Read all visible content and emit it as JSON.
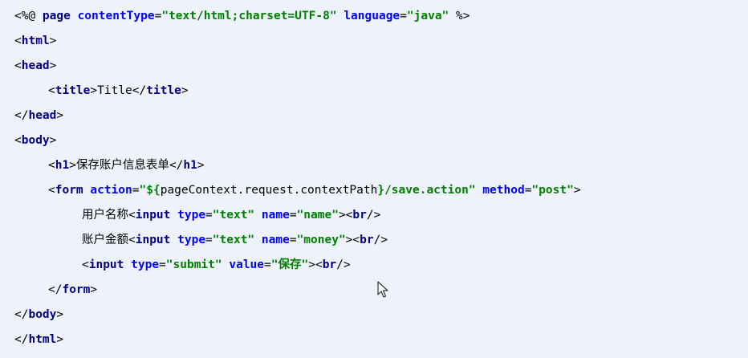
{
  "lines": [
    {
      "indent": 0,
      "tokens": [
        {
          "t": "<%@ ",
          "k": "punct"
        },
        {
          "t": "page",
          "k": "dir"
        },
        {
          "t": " ",
          "k": "text"
        },
        {
          "t": "contentType",
          "k": "attr"
        },
        {
          "t": "=",
          "k": "punct"
        },
        {
          "t": "\"text/html;charset=UTF-8\"",
          "k": "str"
        },
        {
          "t": " ",
          "k": "text"
        },
        {
          "t": "language",
          "k": "attr"
        },
        {
          "t": "=",
          "k": "punct"
        },
        {
          "t": "\"java\"",
          "k": "str"
        },
        {
          "t": " %>",
          "k": "punct"
        }
      ]
    },
    {
      "indent": 0,
      "tokens": [
        {
          "t": "<",
          "k": "punct"
        },
        {
          "t": "html",
          "k": "tag"
        },
        {
          "t": ">",
          "k": "punct"
        }
      ]
    },
    {
      "indent": 0,
      "tokens": [
        {
          "t": "<",
          "k": "punct"
        },
        {
          "t": "head",
          "k": "tag"
        },
        {
          "t": ">",
          "k": "punct"
        }
      ]
    },
    {
      "indent": 1,
      "tokens": [
        {
          "t": "<",
          "k": "punct"
        },
        {
          "t": "title",
          "k": "tag"
        },
        {
          "t": ">",
          "k": "punct"
        },
        {
          "t": "Title",
          "k": "text"
        },
        {
          "t": "</",
          "k": "punct"
        },
        {
          "t": "title",
          "k": "tag"
        },
        {
          "t": ">",
          "k": "punct"
        }
      ]
    },
    {
      "indent": 0,
      "tokens": [
        {
          "t": "</",
          "k": "punct"
        },
        {
          "t": "head",
          "k": "tag"
        },
        {
          "t": ">",
          "k": "punct"
        }
      ]
    },
    {
      "indent": 0,
      "tokens": [
        {
          "t": "<",
          "k": "punct"
        },
        {
          "t": "body",
          "k": "tag"
        },
        {
          "t": ">",
          "k": "punct"
        }
      ]
    },
    {
      "indent": 1,
      "tokens": [
        {
          "t": "<",
          "k": "punct"
        },
        {
          "t": "h1",
          "k": "tag"
        },
        {
          "t": ">",
          "k": "punct"
        },
        {
          "t": "保存账户信息表单",
          "k": "text"
        },
        {
          "t": "</",
          "k": "punct"
        },
        {
          "t": "h1",
          "k": "tag"
        },
        {
          "t": ">",
          "k": "punct"
        }
      ]
    },
    {
      "indent": 1,
      "tokens": [
        {
          "t": "<",
          "k": "punct"
        },
        {
          "t": "form",
          "k": "tag"
        },
        {
          "t": " ",
          "k": "text"
        },
        {
          "t": "action",
          "k": "attr"
        },
        {
          "t": "=",
          "k": "punct"
        },
        {
          "t": "\"${",
          "k": "str"
        },
        {
          "t": "pageContext.request.contextPath",
          "k": "text"
        },
        {
          "t": "}/save.action\"",
          "k": "str"
        },
        {
          "t": " ",
          "k": "text"
        },
        {
          "t": "method",
          "k": "attr"
        },
        {
          "t": "=",
          "k": "punct"
        },
        {
          "t": "\"post\"",
          "k": "str"
        },
        {
          "t": ">",
          "k": "punct"
        }
      ]
    },
    {
      "indent": 2,
      "tokens": [
        {
          "t": "用户名称",
          "k": "text"
        },
        {
          "t": "<",
          "k": "punct"
        },
        {
          "t": "input",
          "k": "tag"
        },
        {
          "t": " ",
          "k": "text"
        },
        {
          "t": "type",
          "k": "attr"
        },
        {
          "t": "=",
          "k": "punct"
        },
        {
          "t": "\"text\"",
          "k": "str"
        },
        {
          "t": " ",
          "k": "text"
        },
        {
          "t": "name",
          "k": "attr"
        },
        {
          "t": "=",
          "k": "punct"
        },
        {
          "t": "\"name\"",
          "k": "str"
        },
        {
          "t": "><",
          "k": "punct"
        },
        {
          "t": "br",
          "k": "tag"
        },
        {
          "t": "/>",
          "k": "punct"
        }
      ]
    },
    {
      "indent": 2,
      "tokens": [
        {
          "t": "账户金额",
          "k": "text"
        },
        {
          "t": "<",
          "k": "punct"
        },
        {
          "t": "input",
          "k": "tag"
        },
        {
          "t": " ",
          "k": "text"
        },
        {
          "t": "type",
          "k": "attr"
        },
        {
          "t": "=",
          "k": "punct"
        },
        {
          "t": "\"text\"",
          "k": "str"
        },
        {
          "t": " ",
          "k": "text"
        },
        {
          "t": "name",
          "k": "attr"
        },
        {
          "t": "=",
          "k": "punct"
        },
        {
          "t": "\"money\"",
          "k": "str"
        },
        {
          "t": "><",
          "k": "punct"
        },
        {
          "t": "br",
          "k": "tag"
        },
        {
          "t": "/>",
          "k": "punct"
        }
      ]
    },
    {
      "indent": 2,
      "tokens": [
        {
          "t": "<",
          "k": "punct"
        },
        {
          "t": "input",
          "k": "tag"
        },
        {
          "t": " ",
          "k": "text"
        },
        {
          "t": "type",
          "k": "attr"
        },
        {
          "t": "=",
          "k": "punct"
        },
        {
          "t": "\"submit\"",
          "k": "str"
        },
        {
          "t": " ",
          "k": "text"
        },
        {
          "t": "value",
          "k": "attr"
        },
        {
          "t": "=",
          "k": "punct"
        },
        {
          "t": "\"保存\"",
          "k": "str"
        },
        {
          "t": "><",
          "k": "punct"
        },
        {
          "t": "br",
          "k": "tag"
        },
        {
          "t": "/>",
          "k": "punct"
        }
      ]
    },
    {
      "indent": 1,
      "tokens": [
        {
          "t": "</",
          "k": "punct"
        },
        {
          "t": "form",
          "k": "tag"
        },
        {
          "t": ">",
          "k": "punct"
        }
      ]
    },
    {
      "indent": 0,
      "tokens": [
        {
          "t": "</",
          "k": "punct"
        },
        {
          "t": "body",
          "k": "tag"
        },
        {
          "t": ">",
          "k": "punct"
        }
      ]
    },
    {
      "indent": 0,
      "tokens": [
        {
          "t": "</",
          "k": "punct"
        },
        {
          "t": "html",
          "k": "tag"
        },
        {
          "t": ">",
          "k": "punct"
        }
      ]
    }
  ],
  "icons": {
    "cursor": "mouse-pointer-icon"
  },
  "colors": {
    "background": "#eef3fb",
    "tag": "#000080",
    "attribute": "#0000ff",
    "string": "#008000"
  }
}
